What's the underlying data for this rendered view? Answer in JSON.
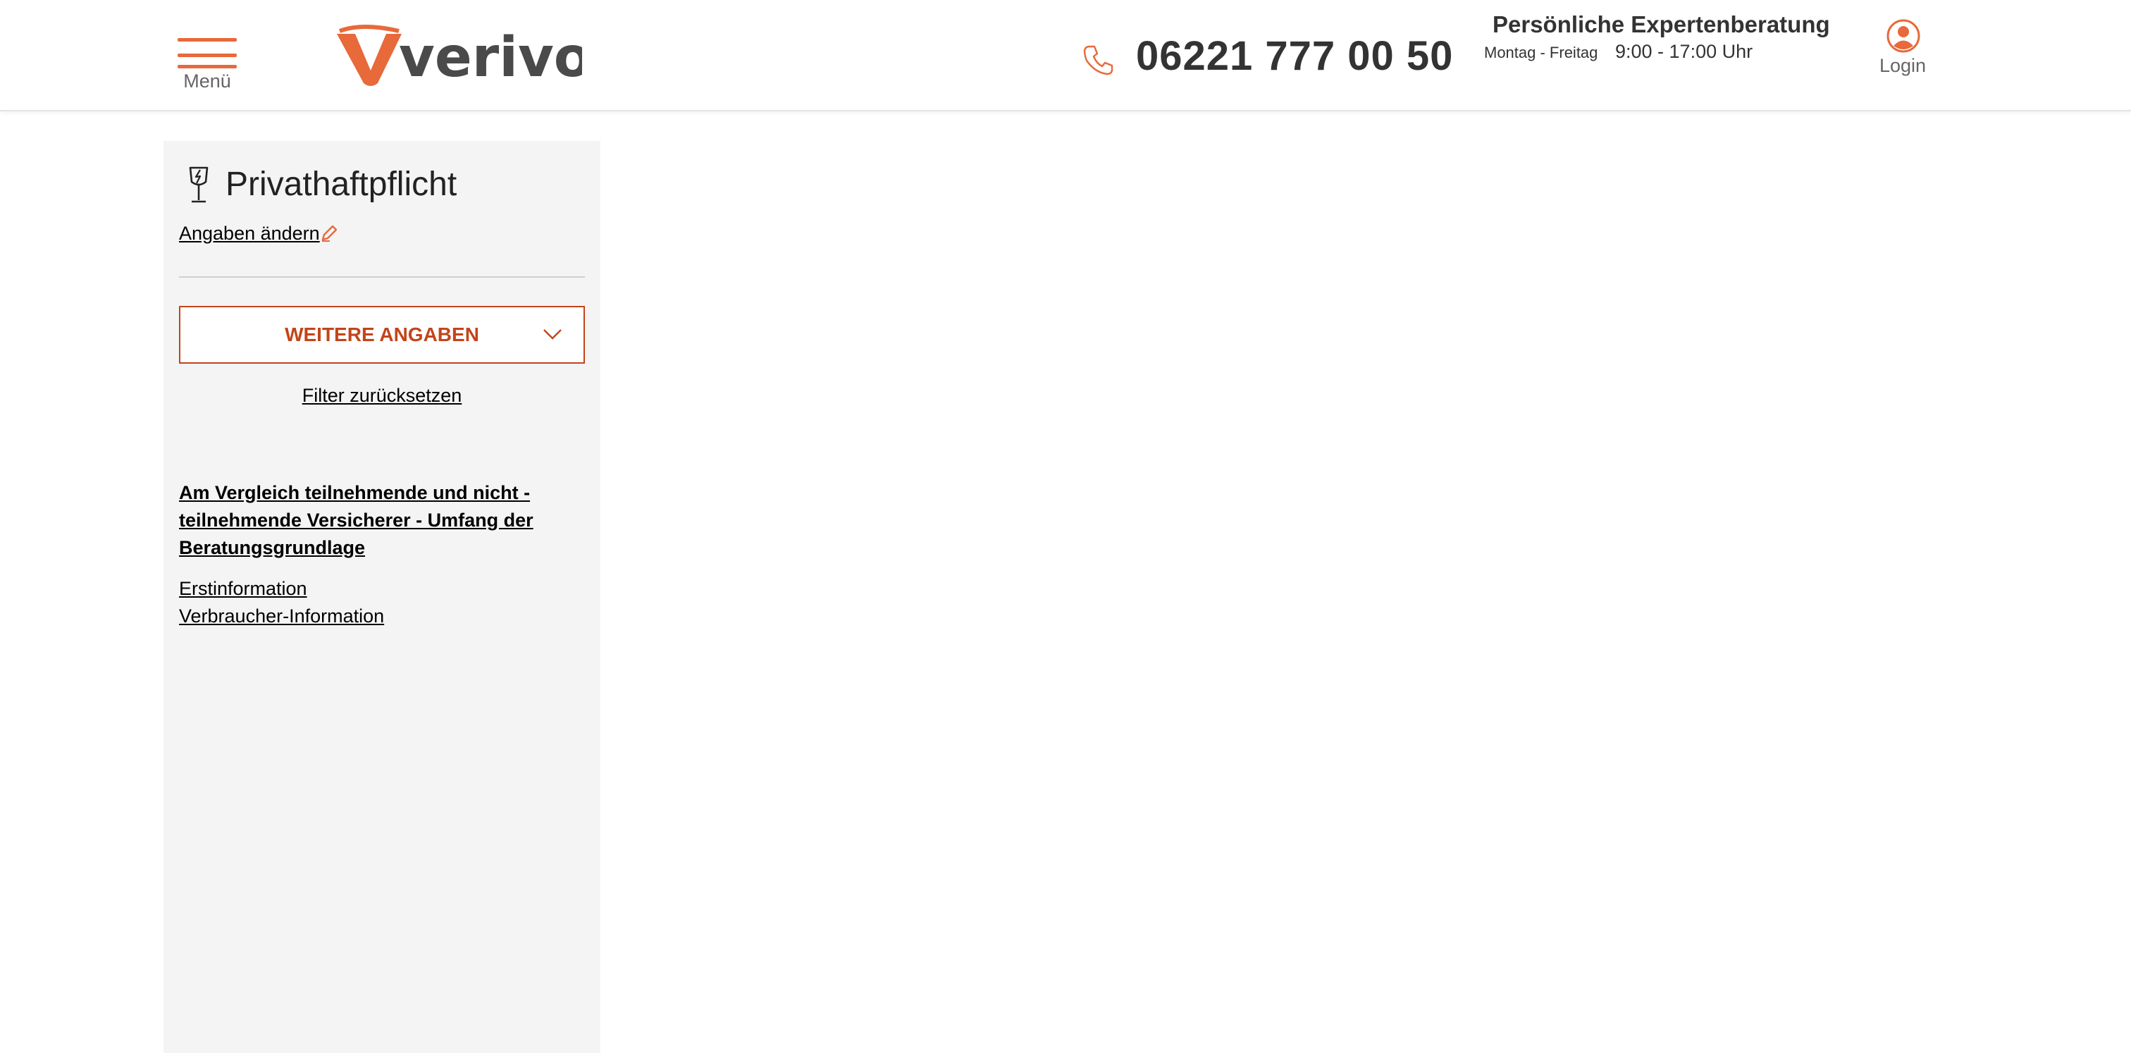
{
  "header": {
    "menu_label": "Menü",
    "logo_text": "verivox",
    "brand_color": "#e8693a",
    "phone_icon": "phone-icon",
    "phone_number": "06221 777 00 50",
    "consult_title": "Persönliche Expertenberatung",
    "consult_days": "Montag - Freitag",
    "consult_hours": "9:00 - 17:00 Uhr",
    "login_label": "Login",
    "login_icon": "user-circle-icon"
  },
  "sidebar": {
    "product_icon": "broken-glass-icon",
    "product_title": "Privathaftpflicht",
    "edit_link": "Angaben ändern",
    "edit_icon": "pencil-icon",
    "more_button": "WEITERE ANGABEN",
    "more_button_color": "#c2451a",
    "reset_link": "Filter zurücksetzen",
    "insurers_link": "Am Vergleich teilnehmende und nicht - teilnehmende Versicherer - Umfang der Beratungsgrundlage",
    "info_links": [
      "Erstinformation",
      "Verbraucher-Information"
    ]
  }
}
